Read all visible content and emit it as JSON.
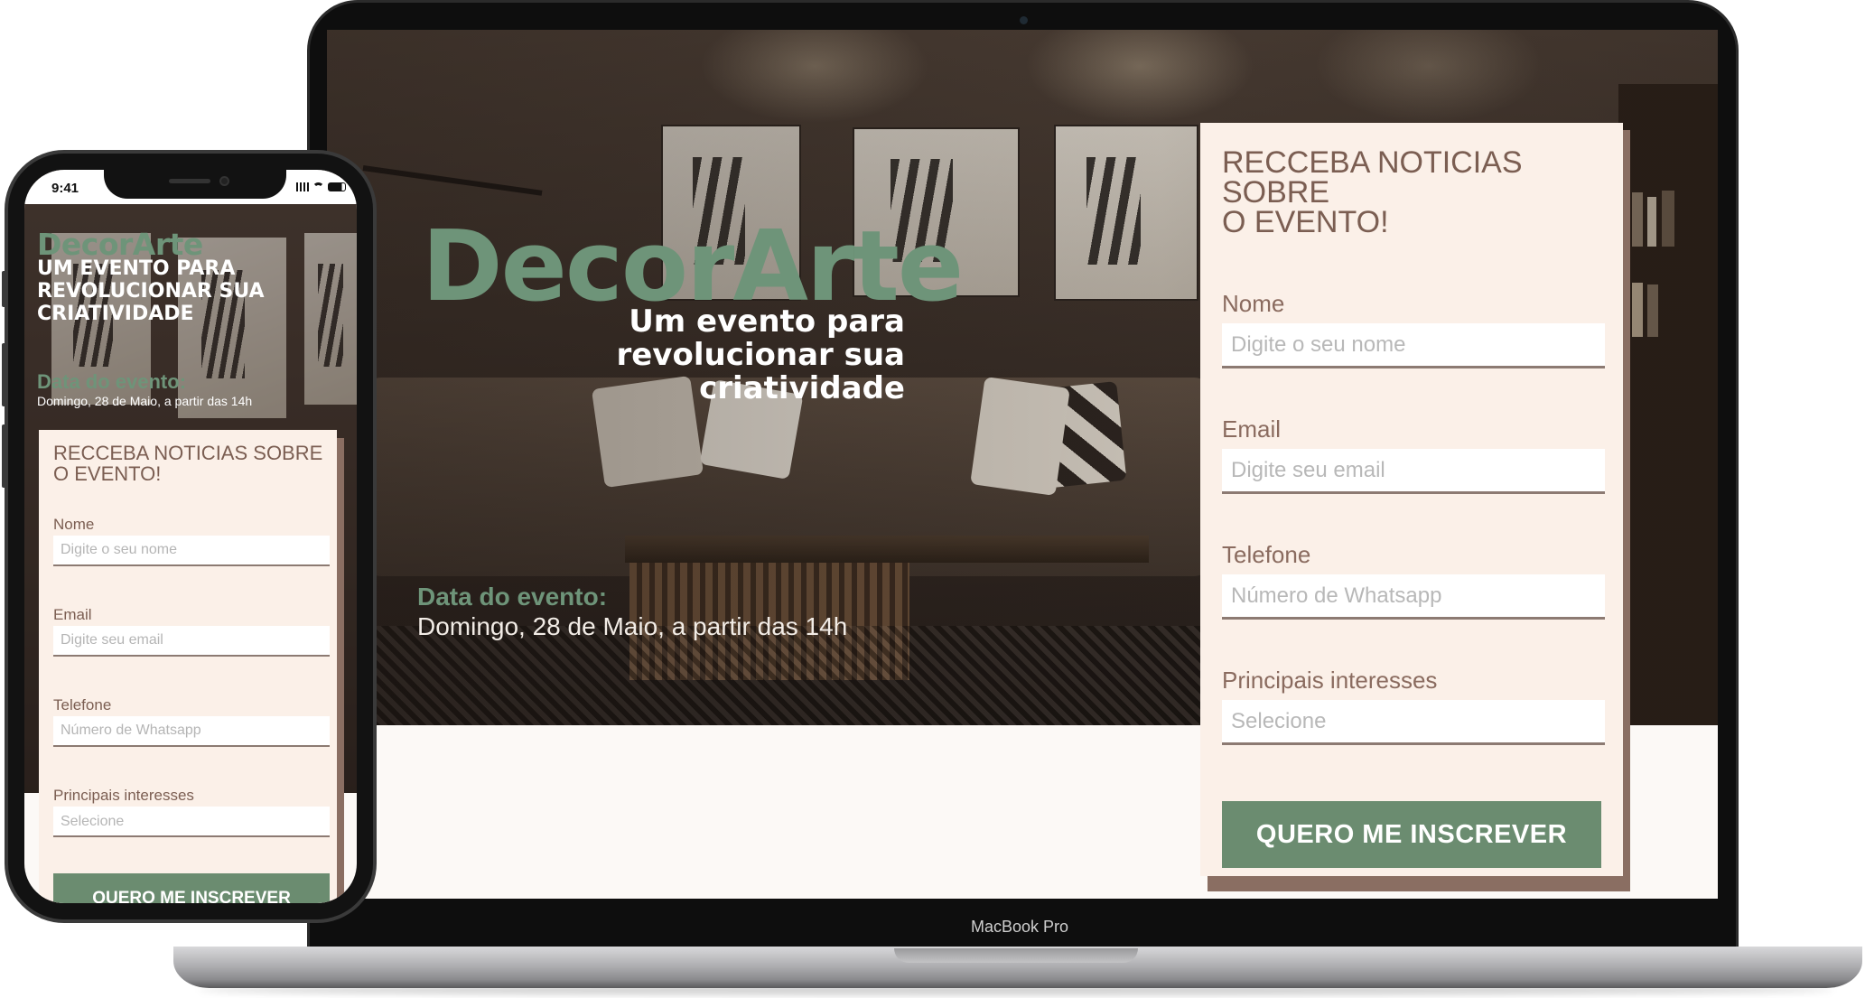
{
  "device_labels": {
    "laptop_model": "MacBook Pro"
  },
  "hero": {
    "brand": "DecorArte",
    "tagline_desktop_lines": [
      "Um evento para",
      "revolucionar sua",
      "criatividade"
    ],
    "tagline_mobile_lines": [
      "UM EVENTO PARA",
      "REVOLUCIONAR SUA",
      "CRIATIVIDADE"
    ],
    "event_label": "Data do evento:",
    "event_date": "Domingo, 28 de Maio, a partir das 14h"
  },
  "form": {
    "title_lines": [
      "RECCEBA NOTICIAS SOBRE",
      "O EVENTO!"
    ],
    "fields": [
      {
        "label": "Nome",
        "placeholder": "Digite o seu nome"
      },
      {
        "label": "Email",
        "placeholder": "Digite seu email"
      },
      {
        "label": "Telefone",
        "placeholder": "Número de Whatsapp"
      }
    ],
    "interests": {
      "label": "Principais interesses",
      "selected": "Selecione"
    },
    "submit_label": "QUERO ME INSCREVER"
  },
  "phone_status": {
    "time": "9:41",
    "icons": [
      "signal-icon",
      "wifi-icon",
      "battery-icon"
    ]
  },
  "colors": {
    "accent_green": "#6b8c70",
    "brand_green": "#6e9479",
    "form_background": "#fbf0e8",
    "form_shadow": "#8a6e62",
    "title_brown": "#7b5e52"
  }
}
